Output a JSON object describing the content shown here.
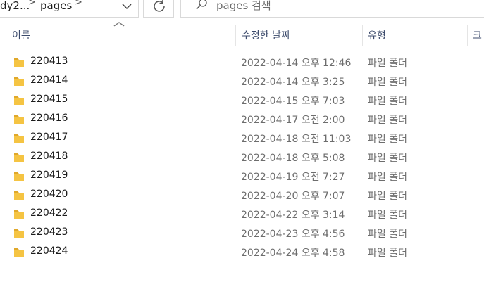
{
  "address_bar": {
    "prev_crumb": "dy2...",
    "current": "pages",
    "separator": ">"
  },
  "search": {
    "placeholder": "pages 검색"
  },
  "icons": {
    "dropdown": "chevron-down-icon",
    "refresh": "refresh-icon",
    "search": "search-icon",
    "folder": "folder-icon"
  },
  "columns": {
    "name": "이름",
    "date": "수정한 날짜",
    "type": "유형",
    "size": "크"
  },
  "files": [
    {
      "name": "220413",
      "date": "2022-04-14 오후 12:46",
      "type": "파일 폴더"
    },
    {
      "name": "220414",
      "date": "2022-04-14 오후 3:25",
      "type": "파일 폴더"
    },
    {
      "name": "220415",
      "date": "2022-04-15 오후 7:03",
      "type": "파일 폴더"
    },
    {
      "name": "220416",
      "date": "2022-04-17 오전 2:00",
      "type": "파일 폴더"
    },
    {
      "name": "220417",
      "date": "2022-04-18 오전 11:03",
      "type": "파일 폴더"
    },
    {
      "name": "220418",
      "date": "2022-04-18 오후 5:08",
      "type": "파일 폴더"
    },
    {
      "name": "220419",
      "date": "2022-04-19 오전 7:27",
      "type": "파일 폴더"
    },
    {
      "name": "220420",
      "date": "2022-04-20 오후 7:07",
      "type": "파일 폴더"
    },
    {
      "name": "220422",
      "date": "2022-04-22 오후 3:14",
      "type": "파일 폴더"
    },
    {
      "name": "220423",
      "date": "2022-04-23 오후 4:56",
      "type": "파일 폴더"
    },
    {
      "name": "220424",
      "date": "2022-04-24 오후 4:58",
      "type": "파일 폴더"
    }
  ],
  "colors": {
    "folder_fill": "#f5c443",
    "folder_tab": "#e0a82a",
    "header_text": "#3b4a6b",
    "secondary_text": "#6d6d6d"
  }
}
